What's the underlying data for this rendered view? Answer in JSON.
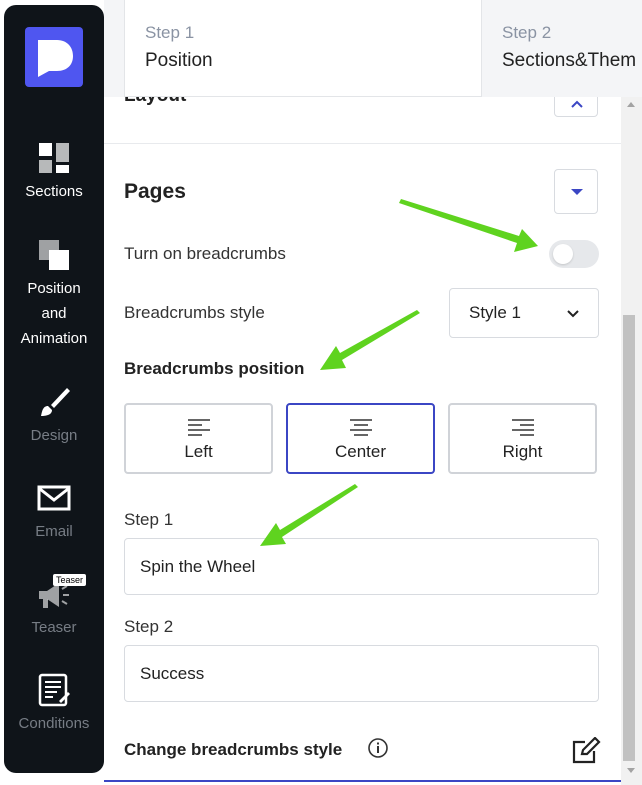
{
  "sidebar": {
    "items": [
      {
        "label": "Sections",
        "icon": "sections-icon"
      },
      {
        "label": "Position and Animation",
        "icon": "position-animation-icon"
      },
      {
        "label": "Design",
        "icon": "brush-icon"
      },
      {
        "label": "Email",
        "icon": "envelope-icon"
      },
      {
        "label": "Teaser",
        "icon": "megaphone-icon",
        "badge": "Teaser"
      },
      {
        "label": "Conditions",
        "icon": "checklist-icon"
      }
    ]
  },
  "steps": [
    {
      "number": "Step 1",
      "name": "Position"
    },
    {
      "number": "Step 2",
      "name": "Sections&Them"
    }
  ],
  "panel": {
    "layout_title": "Layout",
    "pages_title": "Pages",
    "breadcrumbs_toggle_label": "Turn on breadcrumbs",
    "breadcrumbs_enabled": false,
    "breadcrumbs_style_label": "Breadcrumbs style",
    "breadcrumbs_style_value": "Style 1",
    "breadcrumbs_position_label": "Breadcrumbs position",
    "position_options": [
      "Left",
      "Center",
      "Right"
    ],
    "position_selected": "Center",
    "step1_label": "Step 1",
    "step1_value": "Spin the Wheel",
    "step2_label": "Step 2",
    "step2_value": "Success",
    "change_style_label": "Change breadcrumbs style"
  },
  "colors": {
    "sidebar_bg": "#0f1419",
    "accent": "#3b46c4",
    "logo": "#4f56f0",
    "annotation_arrow": "#5fd31f"
  }
}
